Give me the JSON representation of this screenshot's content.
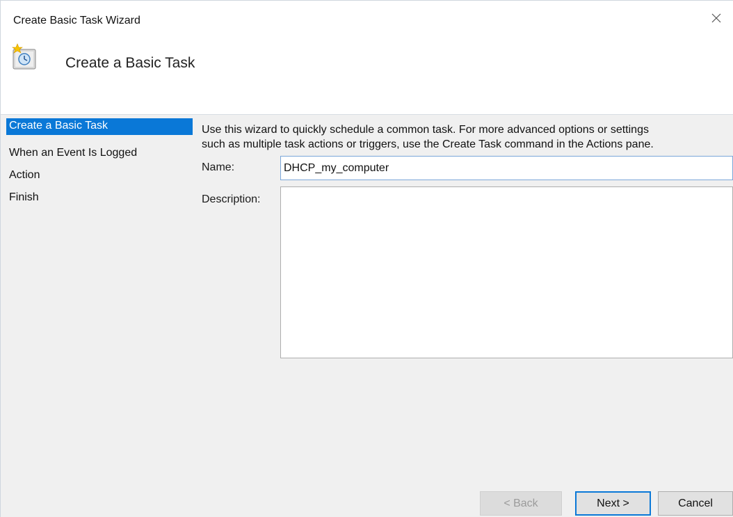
{
  "window": {
    "title": "Create Basic Task Wizard",
    "close_icon": "close-icon"
  },
  "header": {
    "title": "Create a Basic Task",
    "icon": "task-scheduler-icon"
  },
  "steps": [
    {
      "label": "Create a Basic Task",
      "selected": true
    },
    {
      "label": "When an Event Is Logged",
      "selected": false
    },
    {
      "label": "Action",
      "selected": false
    },
    {
      "label": "Finish",
      "selected": false
    }
  ],
  "content": {
    "intro_line1": "Use this wizard to quickly schedule a common task.  For more advanced options or settings",
    "intro_line2": "such as multiple task actions or triggers, use the Create Task command in the Actions pane.",
    "name_label": "Name:",
    "name_value": "DHCP_my_computer",
    "description_label": "Description:",
    "description_value": ""
  },
  "buttons": {
    "back": "< Back",
    "next": "Next >",
    "cancel": "Cancel"
  },
  "colors": {
    "selection": "#0a78d7",
    "panel_bg": "#f0f0f0"
  }
}
